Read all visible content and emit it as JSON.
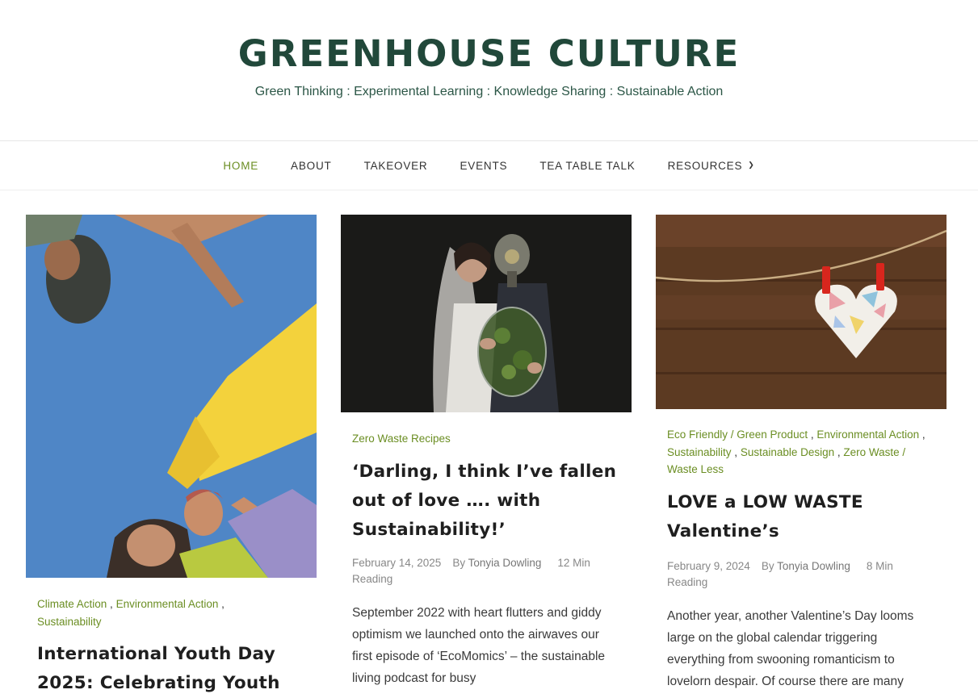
{
  "site": {
    "title": "GREENHOUSE CULTURE",
    "tagline": "Green Thinking : Experimental Learning : Knowledge Sharing : Sustainable Action"
  },
  "nav": {
    "items": [
      "HOME",
      "ABOUT",
      "TAKEOVER",
      "EVENTS",
      "TEA TABLE TALK",
      "RESOURCES"
    ],
    "active": "HOME",
    "dropdown_icon": "chevron-down-icon"
  },
  "colors": {
    "title": "#21483a",
    "accent": "#6b8e23"
  },
  "posts": [
    {
      "categories": [
        "Climate Action",
        "Environmental Action",
        "Sustainability"
      ],
      "title": "International Youth Day 2025: Celebrating Youth",
      "image": "upside-down photo of young people holding hands against blue sky"
    },
    {
      "categories": [
        "Zero Waste Recipes"
      ],
      "title": "‘Darling, I think I’ve fallen out of love …. with Sustainability!’",
      "date": "February 14, 2025",
      "by": "By",
      "author": "Tonyia Dowling",
      "reading_time": "12 Min Reading",
      "excerpt": "September 2022 with heart flutters and giddy optimism we launched onto the airwaves our first episode of ‘EcoMomics’ – the sustainable living podcast for busy",
      "image": "bride and groom in gas mask holding terrarium"
    },
    {
      "categories": [
        "Eco Friendly / Green Product",
        "Environmental Action",
        "Sustainability",
        "Sustainable Design",
        "Zero Waste / Waste Less"
      ],
      "title": "LOVE a LOW WASTE Valentine’s",
      "date": "February 9, 2024",
      "by": "By",
      "author": "Tonyia Dowling",
      "reading_time": "8 Min Reading",
      "excerpt": "Another year, another Valentine’s Day looms large on the global calendar triggering everything from swooning romanticism to lovelorn despair. Of course there are many",
      "image": "origami paper heart pegged on string against wood"
    }
  ]
}
